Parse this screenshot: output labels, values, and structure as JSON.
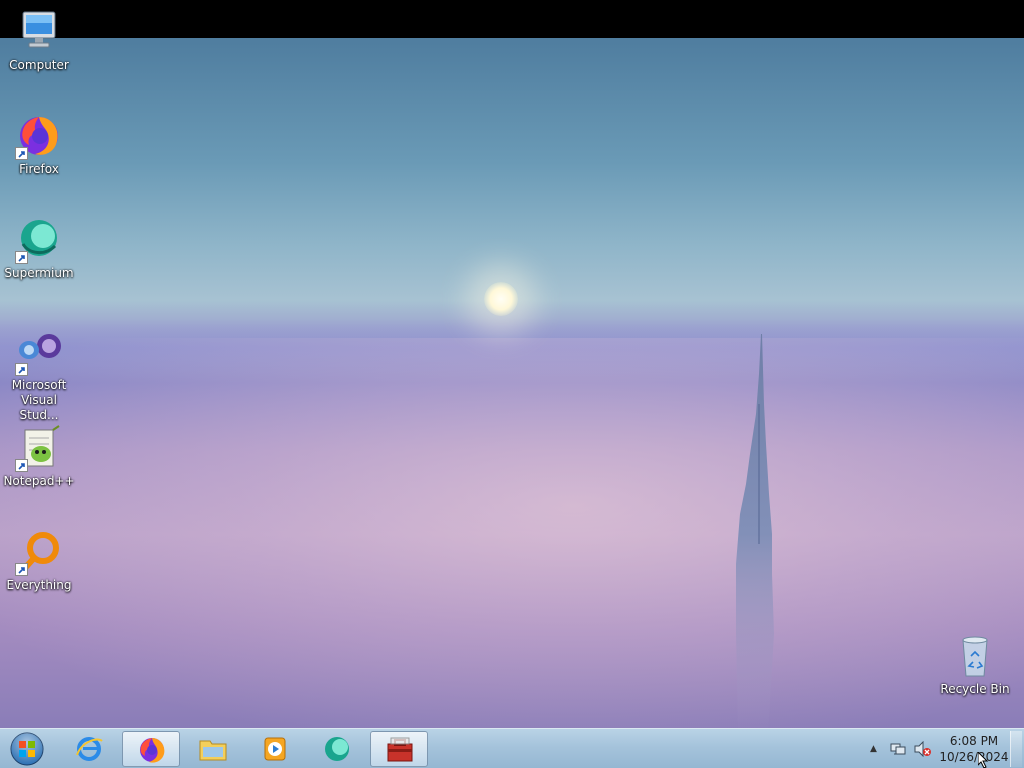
{
  "desktop": {
    "icons": [
      {
        "label": "Computer",
        "icon": "computer-icon",
        "shortcut": false
      },
      {
        "label": "Firefox",
        "icon": "firefox-icon",
        "shortcut": true
      },
      {
        "label": "Supermium",
        "icon": "supermium-icon",
        "shortcut": true
      },
      {
        "label": "Microsoft Visual Stud...",
        "icon": "visual-studio-icon",
        "shortcut": true
      },
      {
        "label": "Notepad++",
        "icon": "notepadpp-icon",
        "shortcut": true
      },
      {
        "label": "Everything",
        "icon": "everything-icon",
        "shortcut": true
      }
    ],
    "recycle_bin": {
      "label": "Recycle Bin",
      "icon": "recycle-bin-icon"
    }
  },
  "taskbar": {
    "start": {
      "icon": "windows-start-icon"
    },
    "pinned": [
      {
        "name": "Internet Explorer",
        "icon": "internet-explorer-icon",
        "active": false
      },
      {
        "name": "Firefox",
        "icon": "firefox-icon",
        "active": true
      },
      {
        "name": "Windows Explorer",
        "icon": "folder-icon",
        "active": false
      },
      {
        "name": "Windows Media Player",
        "icon": "media-player-icon",
        "active": false
      },
      {
        "name": "Supermium",
        "icon": "supermium-icon",
        "active": false
      },
      {
        "name": "Toolbox",
        "icon": "toolbox-icon",
        "active": true
      }
    ],
    "tray": {
      "show_hidden": "▲",
      "icons": [
        "network-icon",
        "volume-muted-icon"
      ]
    },
    "clock": {
      "time": "6:08 PM",
      "date": "10/26/2024"
    }
  },
  "colors": {
    "taskbar": "#a5c3db",
    "desktop_text": "#ffffff",
    "top_bar": "#000000"
  }
}
